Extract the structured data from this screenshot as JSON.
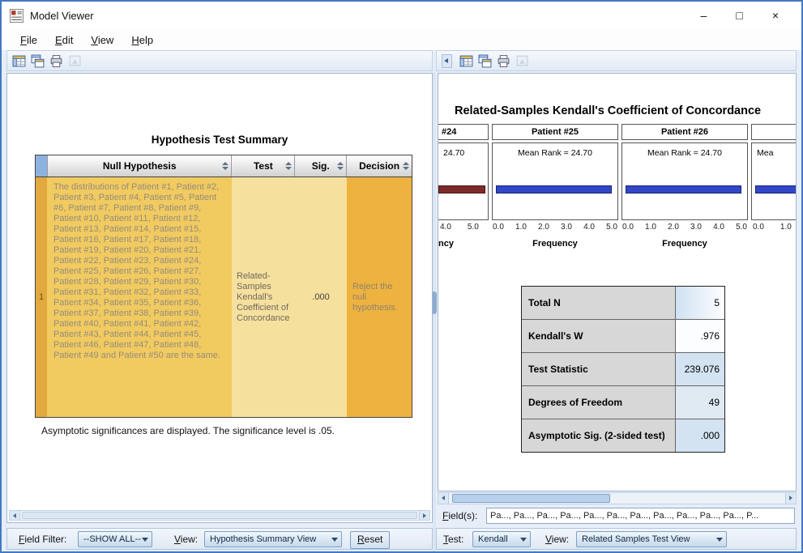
{
  "window": {
    "title": "Model Viewer",
    "controls": {
      "minimize": "–",
      "maximize": "□",
      "close": "×"
    }
  },
  "menu": {
    "items": [
      "File",
      "Edit",
      "View",
      "Help"
    ]
  },
  "icons": {
    "titlebar": "model-viewer-app-icon",
    "toolbar": [
      "pivot-table-icon",
      "copy-table-icon",
      "print-icon",
      "export-icon"
    ],
    "panel": [
      "collapse-left-icon"
    ]
  },
  "left": {
    "title": "Hypothesis Test Summary",
    "table": {
      "columns": [
        "Null Hypothesis",
        "Test",
        "Sig.",
        "Decision"
      ],
      "row": {
        "num": "1",
        "null_hypothesis": "The distributions of Patient #1, Patient #2, Patient #3, Patient #4, Patient #5, Patient #6, Patient #7, Patient #8, Patient #9, Patient #10, Patient #11, Patient #12, Patient #13, Patient #14, Patient #15, Patient #16, Patient #17, Patient #18, Patient #19, Patient #20, Patient #21, Patient #22, Patient #23, Patient #24, Patient #25, Patient #26, Patient #27, Patient #28, Patient #29, Patient #30, Patient #31, Patient #32, Patient #33, Patient #34, Patient #35, Patient #36, Patient #37, Patient #38, Patient #39, Patient #40, Patient #41, Patient #42, Patient #43, Patient #44, Patient #45, Patient #46, Patient #47, Patient #48, Patient #49 and Patient #50 are the same.",
        "test": "Related-Samples Kendall's Coefficient of Concordance",
        "sig": ".000",
        "decision": "Reject the null hypothesis."
      }
    },
    "footnote": "Asymptotic significances are displayed.  The significance level is .05.",
    "bottom": {
      "field_filter_label": "Field Filter:",
      "field_filter_value": "--SHOW ALL--",
      "view_label": "View:",
      "view_value": "Hypothesis Summary View",
      "reset": "Reset"
    }
  },
  "right": {
    "title": "Related-Samples Kendall's Coefficient of Concordance",
    "stats": {
      "rows": [
        {
          "label": "Total N",
          "value": "5"
        },
        {
          "label": "Kendall's W",
          "value": ".976"
        },
        {
          "label": "Test Statistic",
          "value": "239.076"
        },
        {
          "label": "Degrees of Freedom",
          "value": "49"
        },
        {
          "label": "Asymptotic Sig. (2-sided test)",
          "value": ".000"
        }
      ]
    },
    "bottom": {
      "fields_label": "Field(s):",
      "fields_value": "Pa..., Pa..., Pa..., Pa..., Pa..., Pa..., Pa..., Pa..., Pa..., Pa..., Pa..., P...",
      "test_label": "Test:",
      "test_value": "Kendall",
      "view_label": "View:",
      "view_value": "Related Samples Test View"
    }
  },
  "chart_data": {
    "type": "bar",
    "layout": "paneled-horizontal-bars",
    "title": "Related-Samples Kendall's Coefficient of Concordance",
    "xlabel": "Frequency",
    "x_range": [
      0.0,
      5.0
    ],
    "mean_rank": 24.7,
    "bar_colors": {
      "highlight": "#7d2a2a",
      "default": "#3246c8"
    },
    "panels": [
      {
        "header": "#24",
        "annotation": "24.70",
        "bar_color": "#7d2a2a",
        "ticks": [
          "4.0",
          "5.0"
        ],
        "xlabel": "ncy",
        "clipped": "left"
      },
      {
        "header": "Patient #25",
        "annotation": "Mean Rank = 24.70",
        "bar_color": "#3246c8",
        "ticks": [
          "0.0",
          "1.0",
          "2.0",
          "3.0",
          "4.0",
          "5.0"
        ],
        "xlabel": "Frequency"
      },
      {
        "header": "Patient #26",
        "annotation": "Mean Rank = 24.70",
        "bar_color": "#3246c8",
        "ticks": [
          "0.0",
          "1.0",
          "2.0",
          "3.0",
          "4.0",
          "5.0"
        ],
        "xlabel": "Frequency"
      },
      {
        "header": "",
        "annotation": "Mea",
        "bar_color": "#3246c8",
        "ticks": [
          "0.0",
          "1.0"
        ],
        "xlabel": "",
        "clipped": "right"
      }
    ]
  }
}
